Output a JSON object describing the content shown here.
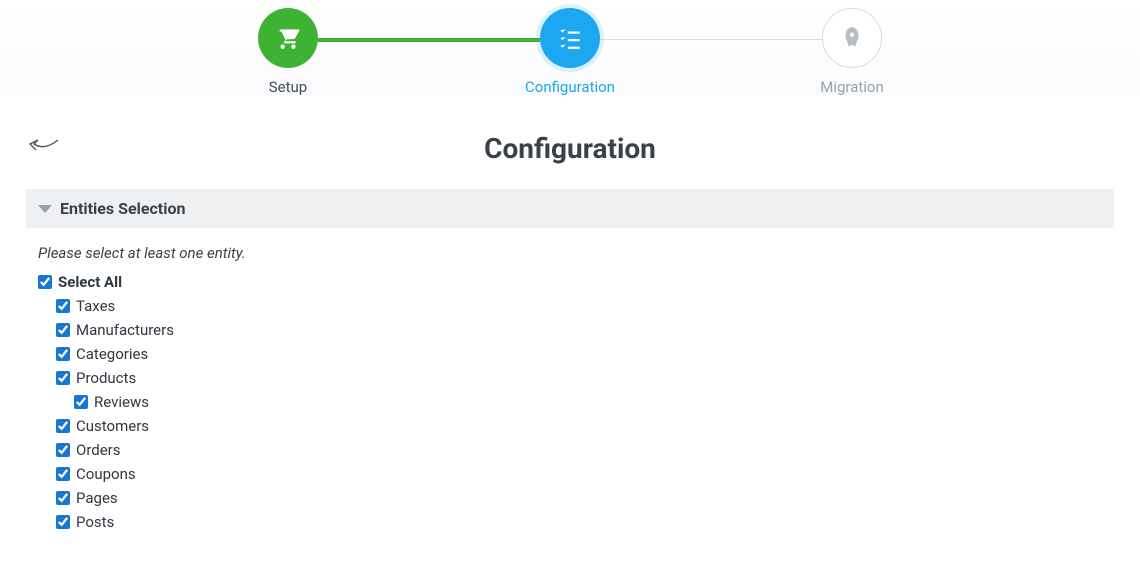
{
  "stepper": {
    "steps": [
      {
        "label": "Setup",
        "state": "done",
        "icon": "cart-icon"
      },
      {
        "label": "Configuration",
        "state": "active",
        "icon": "list-check-icon"
      },
      {
        "label": "Migration",
        "state": "pending",
        "icon": "rocket-icon"
      }
    ]
  },
  "header": {
    "title": "Configuration"
  },
  "section": {
    "title": "Entities Selection",
    "hint": "Please select at least one entity."
  },
  "entities": {
    "selectAllLabel": "Select All",
    "selectAllChecked": true,
    "items": [
      {
        "label": "Taxes",
        "checked": true,
        "indent": 1
      },
      {
        "label": "Manufacturers",
        "checked": true,
        "indent": 1
      },
      {
        "label": "Categories",
        "checked": true,
        "indent": 1
      },
      {
        "label": "Products",
        "checked": true,
        "indent": 1
      },
      {
        "label": "Reviews",
        "checked": true,
        "indent": 2
      },
      {
        "label": "Customers",
        "checked": true,
        "indent": 1
      },
      {
        "label": "Orders",
        "checked": true,
        "indent": 1
      },
      {
        "label": "Coupons",
        "checked": true,
        "indent": 1
      },
      {
        "label": "Pages",
        "checked": true,
        "indent": 1
      },
      {
        "label": "Posts",
        "checked": true,
        "indent": 1
      }
    ]
  }
}
